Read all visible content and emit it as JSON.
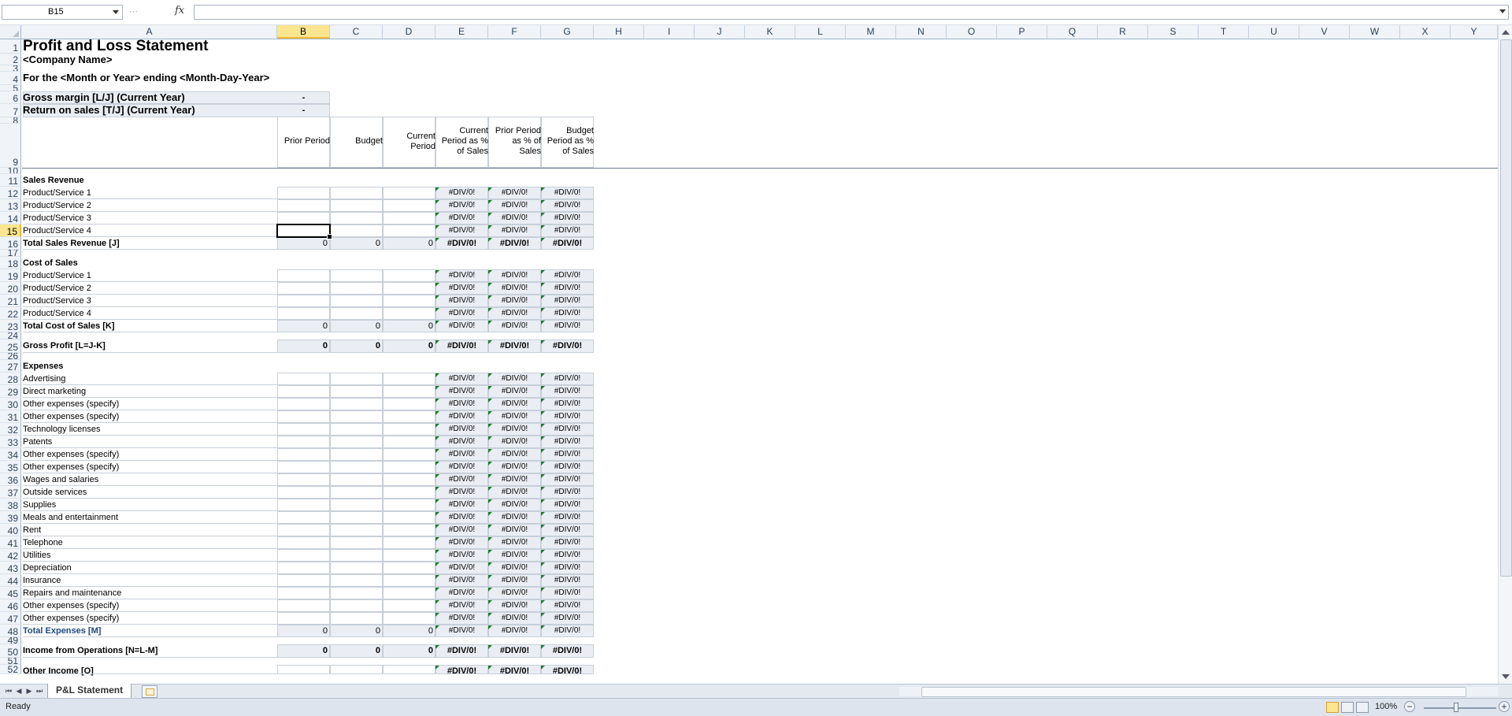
{
  "formula_bar": {
    "name_box": "B15",
    "fx_label": "fx",
    "formula": ""
  },
  "columns": [
    "A",
    "B",
    "C",
    "D",
    "E",
    "F",
    "G",
    "H",
    "I",
    "J",
    "K",
    "L",
    "M",
    "N",
    "O",
    "P",
    "Q",
    "R",
    "S",
    "T",
    "U",
    "V",
    "W",
    "X",
    "Y"
  ],
  "selected_column": "B",
  "selected_row": "15",
  "sheet": {
    "title": "Profit and Loss Statement",
    "company": "<Company Name>",
    "period": "For the <Month or Year> ending <Month-Day-Year>",
    "metrics": [
      {
        "label": "Gross margin  [L/J] (Current Year)",
        "value": "-"
      },
      {
        "label": "Return on sales  [T/J] (Current Year)",
        "value": "-"
      }
    ],
    "headers": [
      "Prior Period",
      "Budget",
      "Current Period",
      "Current Period as % of Sales",
      "Prior Period as % of Sales",
      "Budget Period as % of Sales"
    ],
    "header_lines": [
      [
        "Prior Period"
      ],
      [
        "Budget"
      ],
      [
        "Current",
        "Period"
      ],
      [
        "Current",
        "Period as %",
        "of Sales"
      ],
      [
        "Prior Period",
        "as % of",
        "Sales"
      ],
      [
        "Budget",
        "Period as %",
        "of Sales"
      ]
    ],
    "sections": {
      "sales_title": "Sales Revenue",
      "sales_items": [
        "Product/Service 1",
        "Product/Service 2",
        "Product/Service 3",
        "Product/Service 4"
      ],
      "sales_total": "Total Sales Revenue  [J]",
      "cost_title": "Cost of Sales",
      "cost_items": [
        "Product/Service 1",
        "Product/Service 2",
        "Product/Service 3",
        "Product/Service 4"
      ],
      "cost_total": "Total Cost of Sales  [K]",
      "gross_profit": "Gross Profit  [L=J-K]",
      "expenses_title": "Expenses",
      "expense_items": [
        "Advertising",
        "Direct marketing",
        "Other expenses (specify)",
        "Other expenses (specify)",
        "Technology licenses",
        "Patents",
        "Other expenses (specify)",
        "Other expenses (specify)",
        "Wages and salaries",
        "Outside services",
        "Supplies",
        "Meals and entertainment",
        "Rent",
        "Telephone",
        "Utilities",
        "Depreciation",
        "Insurance",
        "Repairs and maintenance",
        "Other expenses (specify)",
        "Other expenses (specify)"
      ],
      "expenses_total": "Total Expenses [M]",
      "income_ops": "Income from Operations  [N=L-M]",
      "cut_label": "Other Income [O]"
    },
    "zero": "0",
    "div_error": "#DIV/0!"
  },
  "tabs": {
    "active": "P&L Statement"
  },
  "status": {
    "ready": "Ready",
    "zoom": "100%",
    "zoom_minus": "−",
    "zoom_plus": "+"
  },
  "nav_glyphs": [
    "⏮",
    "◀",
    "▶",
    "⏭"
  ]
}
